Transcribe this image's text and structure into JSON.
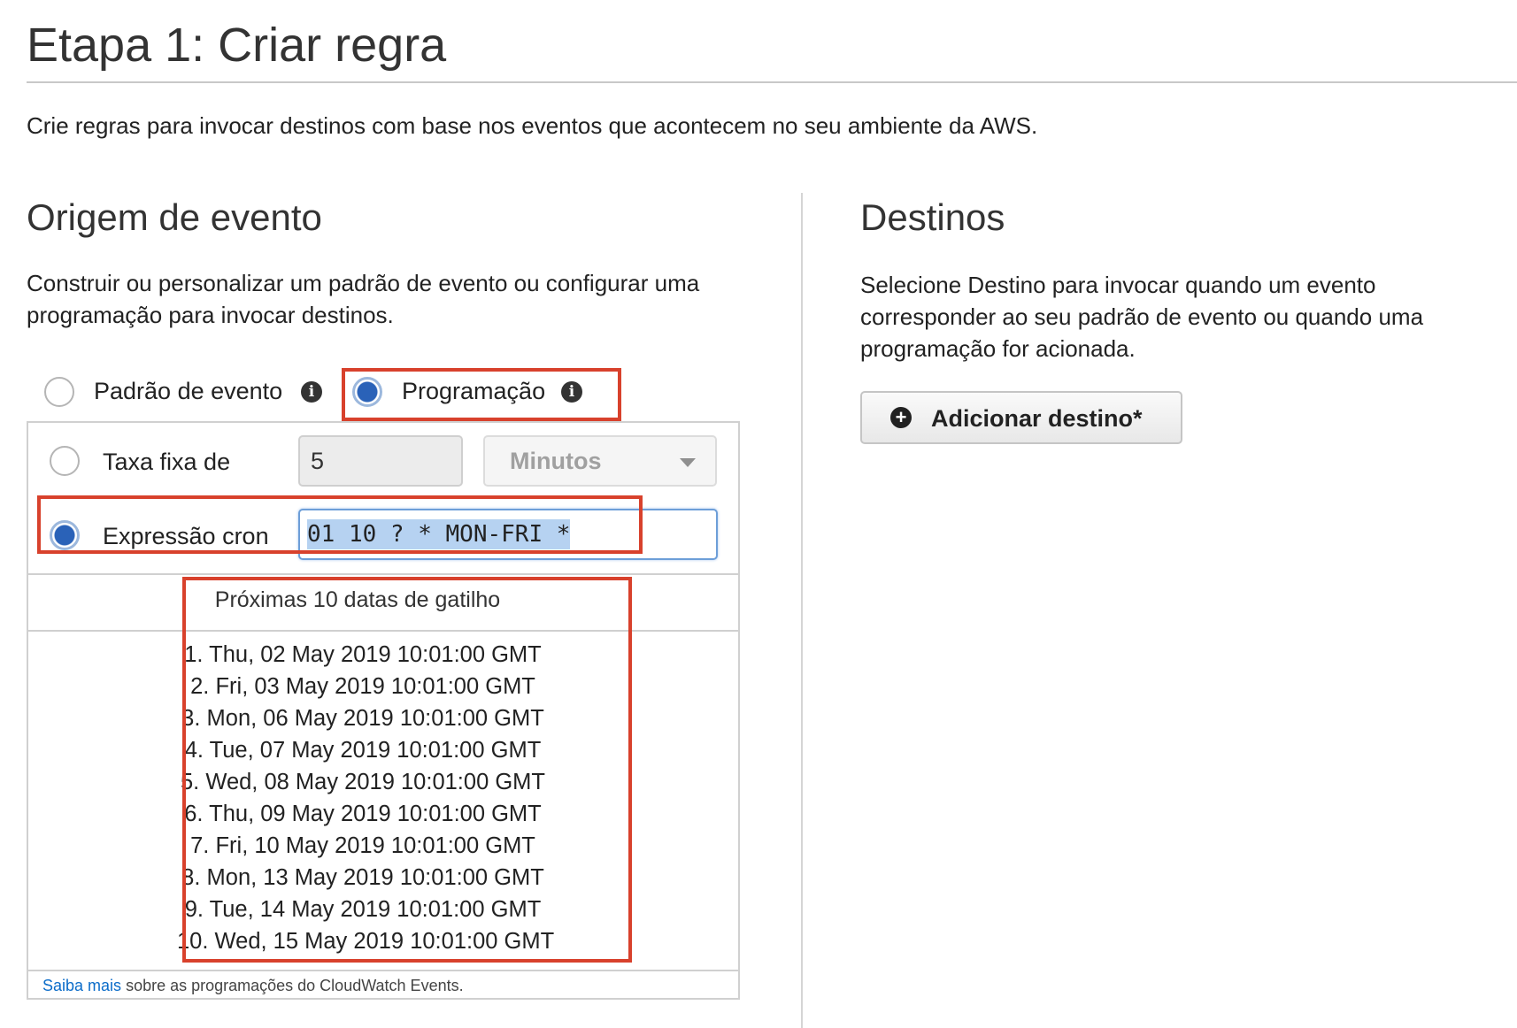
{
  "header": {
    "title": "Etapa 1: Criar regra",
    "description": "Crie regras para invocar destinos com base nos eventos que acontecem no seu ambiente da AWS."
  },
  "event_source": {
    "title": "Origem de evento",
    "description": "Construir ou personalizar um padrão de evento ou configurar uma programação para invocar destinos.",
    "source_options": [
      {
        "label": "Padrão de evento",
        "selected": false
      },
      {
        "label": "Programação",
        "selected": true
      }
    ],
    "schedule": {
      "fixed_rate": {
        "label": "Taxa fixa de",
        "value": "5",
        "unit": "Minutos",
        "selected": false
      },
      "cron": {
        "label": "Expressão cron",
        "value": "01 10 ? * MON-FRI *",
        "selected": true
      },
      "triggers_title": "Próximas 10 datas de gatilho",
      "triggers": [
        "1. Thu, 02 May 2019 10:01:00 GMT",
        "2. Fri, 03 May 2019 10:01:00 GMT",
        "3. Mon, 06 May 2019 10:01:00 GMT",
        "4. Tue, 07 May 2019 10:01:00 GMT",
        "5. Wed, 08 May 2019 10:01:00 GMT",
        "6. Thu, 09 May 2019 10:01:00 GMT",
        "7. Fri, 10 May 2019 10:01:00 GMT",
        "8. Mon, 13 May 2019 10:01:00 GMT",
        "9. Tue, 14 May 2019 10:01:00 GMT",
        "10. Wed, 15 May 2019 10:01:00 GMT"
      ],
      "footer": {
        "link": "Saiba mais",
        "text": "sobre as programações do CloudWatch Events."
      }
    }
  },
  "targets": {
    "title": "Destinos",
    "description": "Selecione Destino para invocar quando um evento corresponder ao seu padrão de evento ou quando uma programação for acionada.",
    "add_button": "Adicionar destino*"
  },
  "colors": {
    "highlight": "#d8412c",
    "radio_selected": "#2a62b8",
    "link": "#0b6cc9"
  },
  "icons": [
    "info-icon",
    "plus-circle-icon",
    "chevron-down-icon"
  ]
}
